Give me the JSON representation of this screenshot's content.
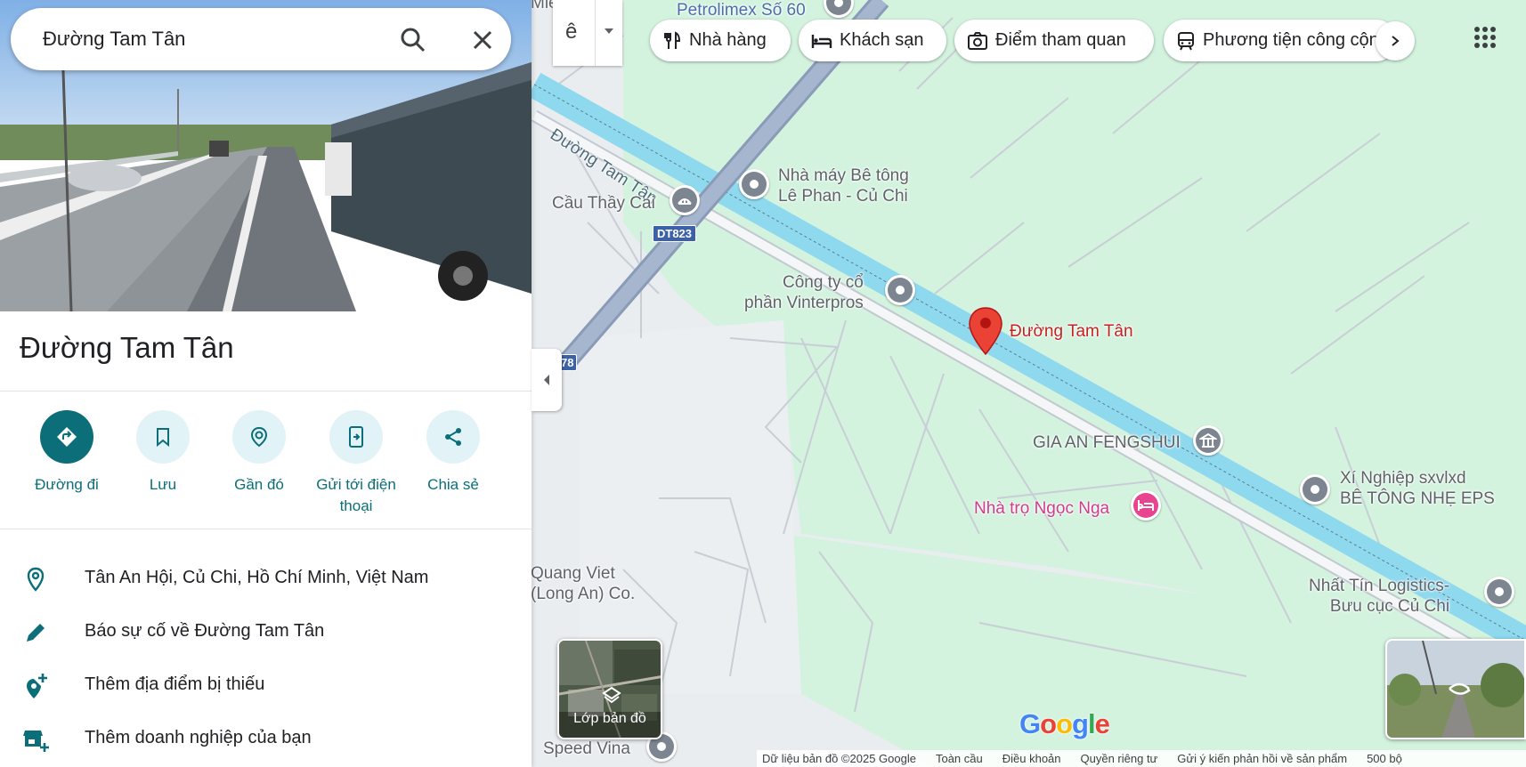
{
  "search": {
    "value": "Đường Tam Tân"
  },
  "place": {
    "title": "Đường Tam Tân",
    "actions": [
      {
        "label": "Đường đi",
        "icon": "directions-icon"
      },
      {
        "label": "Lưu",
        "icon": "bookmark-icon"
      },
      {
        "label": "Gần đó",
        "icon": "nearby-icon"
      },
      {
        "label": "Gửi tới điện thoại",
        "icon": "send-to-phone-icon"
      },
      {
        "label": "Chia sẻ",
        "icon": "share-icon"
      }
    ],
    "info": [
      {
        "text": "Tân An Hội, Củ Chi, Hồ Chí Minh, Việt Nam",
        "icon": "location-pin-icon"
      },
      {
        "text": "Báo sự cố về Đường Tam Tân",
        "icon": "pencil-icon"
      },
      {
        "text": "Thêm địa điểm bị thiếu",
        "icon": "add-location-icon"
      },
      {
        "text": "Thêm doanh nghiệp của bạn",
        "icon": "add-business-icon"
      }
    ]
  },
  "chips": [
    {
      "label": "Nhà hàng",
      "icon": "restaurant-icon"
    },
    {
      "label": "Khách sạn",
      "icon": "hotel-icon"
    },
    {
      "label": "Điểm tham quan",
      "icon": "camera-icon"
    },
    {
      "label": "Phương tiện công cộng",
      "icon": "transit-icon"
    }
  ],
  "ime": {
    "label": "ê"
  },
  "map": {
    "labels": {
      "petrolimex": "Petrolimex Số 60",
      "top_cut": "Miễ",
      "road_name": "Đường Tam Tân",
      "cau_thay_cai": "Cầu Thầy Cai",
      "route_badge": "DT823",
      "route_badge2": "78",
      "nha_may": "Nhà máy Bê tông\nLê Phan - Củ Chi",
      "vinterpros": "Công ty cổ\nphần Vinterpros",
      "pin_label": "Đường Tam Tân",
      "gia_an": "GIA AN FENGSHUI",
      "xi_nghiep": "Xí Nghiệp sxvlxd\nBÊ TÔNG NHẸ EPS",
      "nha_tro": "Nhà trọ Ngọc Nga",
      "quang_viet": "Quang Viet\n(Long An) Co.",
      "nhat_tin": "Nhất Tín Logistics-\nBưu cục Củ Chi",
      "speed_vina": "Speed Vina"
    },
    "layers_label": "Lớp bản đồ",
    "logo": "Google",
    "footer": [
      "Dữ liệu bản đồ ©2025 Google",
      "Toàn cầu",
      "Điều khoản",
      "Quyền riêng tư",
      "Gửi ý kiến phản hồi về sản phẩm",
      "500 bộ"
    ]
  },
  "colors": {
    "accent": "#0b6e78",
    "map_green": "#d3f3df",
    "canal": "#8fd9ef",
    "pin_red": "#ea4335",
    "hotel_pink": "#e8448f"
  }
}
